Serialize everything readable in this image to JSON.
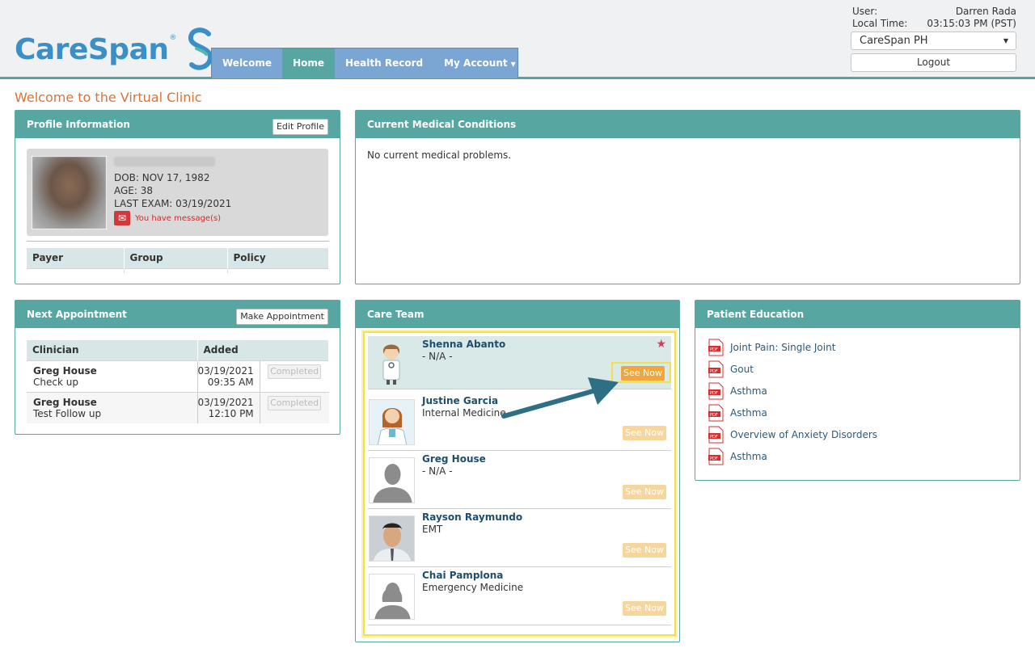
{
  "header": {
    "logo_text": "CareSpan",
    "logo_tm": "®",
    "nav": [
      {
        "label": "Welcome"
      },
      {
        "label": "Home"
      },
      {
        "label": "Health Record"
      },
      {
        "label": "My Account"
      }
    ],
    "user_label": "User:",
    "user_name": "Darren Rada",
    "time_label": "Local Time:",
    "time_value": "03:15:03 PM (PST)",
    "site_selected": "CareSpan PH",
    "logout_label": "Logout"
  },
  "page_title": "Welcome to the Virtual Clinic",
  "profile": {
    "title": "Profile Information",
    "edit_label": "Edit Profile",
    "dob": "DOB: NOV 17, 1982",
    "age": "AGE: 38",
    "last_exam": "LAST EXAM: 03/19/2021",
    "message": "You have message(s)",
    "insurance_headers": [
      "Payer",
      "Group",
      "Policy"
    ]
  },
  "conditions": {
    "title": "Current Medical Conditions",
    "text": "No current medical problems."
  },
  "appointment": {
    "title": "Next Appointment",
    "make_label": "Make Appointment",
    "headers": [
      "Clinician",
      "Added"
    ],
    "rows": [
      {
        "clinician": "Greg House",
        "reason": "Check up",
        "date": "03/19/2021",
        "time": "09:35 AM",
        "status": "Completed"
      },
      {
        "clinician": "Greg House",
        "reason": "Test Follow up",
        "date": "03/19/2021",
        "time": "12:10 PM",
        "status": "Completed"
      }
    ]
  },
  "care_team": {
    "title": "Care Team",
    "members": [
      {
        "name": "Shenna Abanto",
        "specialty": "- N/A -",
        "action": "See Now",
        "avatar": "doctor-cartoon-icon"
      },
      {
        "name": "Justine Garcia",
        "specialty": "Internal Medicine",
        "action": "See Now",
        "avatar": "female-doctor-cartoon-icon"
      },
      {
        "name": "Greg House",
        "specialty": "- N/A -",
        "action": "See Now",
        "avatar": "male-silhouette-icon"
      },
      {
        "name": "Rayson Raymundo",
        "specialty": "EMT",
        "action": "See Now",
        "avatar": "photo"
      },
      {
        "name": "Chai Pamplona",
        "specialty": "Emergency Medicine",
        "action": "See Now",
        "avatar": "female-silhouette-icon"
      }
    ]
  },
  "education": {
    "title": "Patient Education",
    "items": [
      {
        "label": "Joint Pain: Single Joint"
      },
      {
        "label": "Gout"
      },
      {
        "label": "Asthma"
      },
      {
        "label": "Asthma"
      },
      {
        "label": "Overview of Anxiety Disorders"
      },
      {
        "label": "Asthma"
      }
    ]
  },
  "colors": {
    "teal": "#57a6a1",
    "nav_blue": "#7ba6d4",
    "title_orange": "#d9733a",
    "see_now": "#f0a53d",
    "highlight_yellow": "#f1e14e"
  }
}
